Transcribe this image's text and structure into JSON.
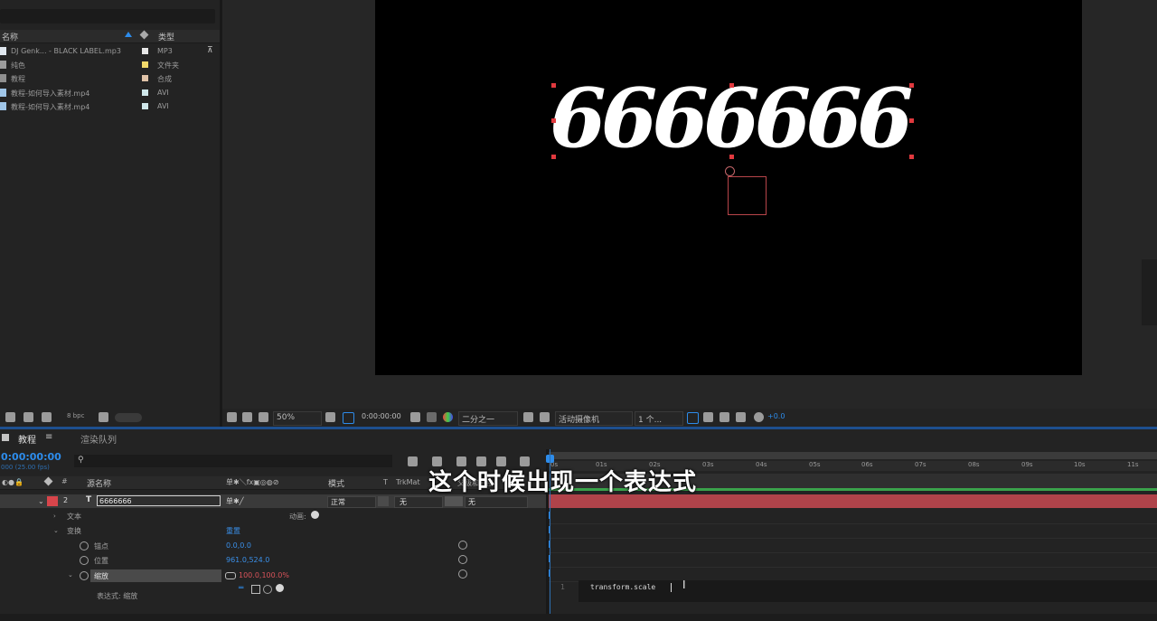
{
  "project": {
    "col_name": "名称",
    "col_type": "类型",
    "items": [
      {
        "name": "DJ Genk... - BLACK LABEL.mp3",
        "type": "MP3",
        "color": "#e6e6e6"
      },
      {
        "name": "纯色",
        "type": "文件夹",
        "color": "#f2d96a"
      },
      {
        "name": "教程",
        "type": "合成",
        "color": "#e0c3a8"
      },
      {
        "name": "教程-如何导入素材.mp4",
        "type": "AVI",
        "color": "#cfe7ea"
      },
      {
        "name": "教程-如何导入素材.mp4",
        "type": "AVI",
        "color": "#cfe7ea"
      }
    ],
    "bpc": "8 bpc"
  },
  "viewer": {
    "comp_text": "6666666",
    "zoom": "50%",
    "timecode": "0:00:00:00",
    "resolution": "二分之一",
    "camera": "活动摄像机",
    "views": "1 个...",
    "exposure": "+0.0"
  },
  "timeline": {
    "tab_comp": "教程",
    "tab_render": "渲染队列",
    "timecode": "0:00:00:00",
    "fps": "000 (25.00 fps)",
    "col_source": "源名称",
    "col_mode": "模式",
    "col_t": "T",
    "col_trkmat": "TrkMat",
    "col_parent": "父级和链接",
    "layer": {
      "index": "2",
      "type": "T",
      "name": "6666666",
      "mode": "正常",
      "trkmat": "无",
      "parent": "无"
    },
    "props": {
      "text": "文本",
      "animate": "动画:",
      "transform": "变换",
      "reset": "重置",
      "anchor_label": "锚点",
      "anchor_value": "0.0,0.0",
      "position_label": "位置",
      "position_value": "961.0,524.0",
      "scale_label": "缩放",
      "scale_value": "100.0,100.0%",
      "expression_label": "表达式: 缩放"
    },
    "ruler": [
      "0s",
      "01s",
      "02s",
      "03s",
      "04s",
      "05s",
      "06s",
      "07s",
      "08s",
      "09s",
      "10s",
      "11s"
    ],
    "expression_line": "1",
    "expression_text": "transform.scale"
  },
  "subtitle": "这个时候出现一个表达式"
}
